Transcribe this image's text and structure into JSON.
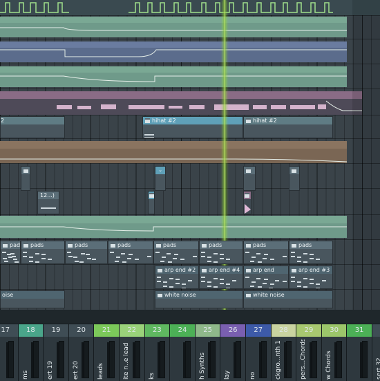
{
  "playlist": {
    "clips": {
      "hihat_a": "2",
      "hihat_b": "hihat #2",
      "hihat_c": "hihat #2",
      "small_clip": "12...)",
      "pads": [
        "pads",
        "pads",
        "pads",
        "pads",
        "pads",
        "pads",
        "pads",
        "pads"
      ],
      "arp": [
        "arp end #2",
        "arp end #4",
        "arp end",
        "arp end #3"
      ],
      "white_noise": [
        "oise",
        "white noise",
        "white noise"
      ]
    }
  },
  "mixer": {
    "strips": [
      {
        "num": "17",
        "label": "",
        "color": "#3f4d55"
      },
      {
        "num": "18",
        "label": "ms",
        "color": "#4aa58a"
      },
      {
        "num": "19",
        "label": "ert 19",
        "color": "#3f4d55"
      },
      {
        "num": "20",
        "label": "ert 20",
        "color": "#3f4d55"
      },
      {
        "num": "21",
        "label": "leads",
        "color": "#7cc95a"
      },
      {
        "num": "22",
        "label": "ite n..e lead",
        "color": "#9ad27a"
      },
      {
        "num": "23",
        "label": "ks",
        "color": "#5fb860"
      },
      {
        "num": "24",
        "label": "",
        "color": "#4cb056"
      },
      {
        "num": "25",
        "label": "h Synths",
        "color": "#8fb88a"
      },
      {
        "num": "26",
        "label": "lay",
        "color": "#7a5fb0"
      },
      {
        "num": "27",
        "label": "no",
        "color": "#3d5aa8"
      },
      {
        "num": "28",
        "label": "ckgro...nth 1",
        "color": "#c9d3a0"
      },
      {
        "num": "29",
        "label": "pers...Chords",
        "color": "#a8c870"
      },
      {
        "num": "30",
        "label": "w Chords",
        "color": "#9cc66a"
      },
      {
        "num": "31",
        "label": "",
        "color": "#4cb056"
      },
      {
        "num": "",
        "label": "sert 32",
        "color": "#3f4d55"
      }
    ]
  }
}
